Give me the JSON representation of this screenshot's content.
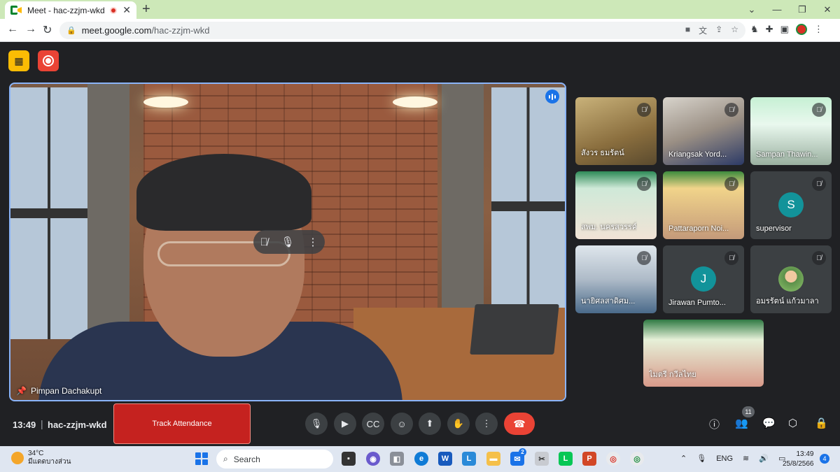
{
  "browser": {
    "tab_title": "Meet - hac-zzjm-wkd",
    "tab_close": "✕",
    "new_tab": "+",
    "url_host": "meet.google.com",
    "url_path": "/hac-zzjm-wkd"
  },
  "meet": {
    "main_speaker": "Pimpan Dachakupt",
    "participants": [
      {
        "name": "สังวร ธมรัตน์",
        "avatar": ""
      },
      {
        "name": "Kriangsak Yord...",
        "avatar": ""
      },
      {
        "name": "Sampan Thawin...",
        "avatar": ""
      },
      {
        "name": "สพม. นครสวรรค์",
        "avatar": ""
      },
      {
        "name": "Pattaraporn Noi...",
        "avatar": ""
      },
      {
        "name": "supervisor",
        "avatar": "S"
      },
      {
        "name": "นายิศลสาดิศม...",
        "avatar": ""
      },
      {
        "name": "Jirawan Pumto...",
        "avatar": "J"
      },
      {
        "name": "อมรรัตน์ แก้วมาลา",
        "avatar": ""
      },
      {
        "name": "ไมตรี กวีลไทย",
        "avatar": ""
      }
    ]
  },
  "bottombar": {
    "time": "13:49",
    "separator": "|",
    "meeting_code": "hac-zzjm-wkd",
    "track_attendance": "Track Attendance",
    "people_count": "11"
  },
  "taskbar": {
    "temperature": "34°C",
    "weather_desc": "มีแดดบางส่วน",
    "search_label": "Search",
    "lang": "ENG",
    "clock_time": "13:49",
    "clock_date": "25/8/2566",
    "notif_count": "4",
    "mail_badge": "2"
  },
  "colors": {
    "accent_blue": "#8ab4f8",
    "end_call_red": "#ea4335",
    "track_btn_red": "#c5221f",
    "meet_bg": "#202124",
    "avatar_teal": "#12939a"
  },
  "icons": [
    "meet-logo-icon",
    "record-dot-icon",
    "close-icon",
    "plus-icon",
    "back-icon",
    "forward-icon",
    "reload-icon",
    "lock-icon",
    "camera-icon",
    "translate-icon",
    "share-icon",
    "star-icon",
    "extension-icon",
    "puzzle-icon",
    "sidepanel-icon",
    "profile-icon",
    "more-icon",
    "mic-off-icon",
    "mic-icon",
    "camera-icon",
    "captions-icon",
    "emoji-icon",
    "present-icon",
    "hand-icon",
    "end-call-icon",
    "info-icon",
    "people-icon",
    "chat-icon",
    "activities-icon",
    "host-controls-icon"
  ]
}
